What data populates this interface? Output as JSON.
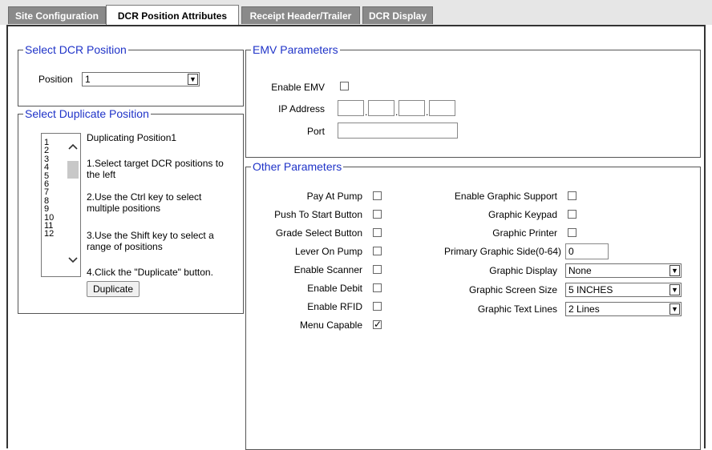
{
  "tabs": [
    {
      "label": "Site Configuration"
    },
    {
      "label": "DCR Position Attributes"
    },
    {
      "label": "Receipt Header/Trailer"
    },
    {
      "label": "DCR Display"
    }
  ],
  "active_tab": "DCR Position Attributes",
  "select_dcr_position": {
    "legend": "Select DCR Position",
    "position_label": "Position",
    "position_value": "1"
  },
  "select_duplicate_position": {
    "legend": "Select Duplicate Position",
    "list_items": [
      "1",
      "2",
      "3",
      "4",
      "5",
      "6",
      "7",
      "8",
      "9",
      "10",
      "11",
      "12"
    ],
    "heading": "Duplicating Position1",
    "instructions": [
      "1.Select target DCR positions to the left",
      "2.Use the Ctrl key to select multiple positions",
      "3.Use the Shift key to select a range of positions",
      "4.Click the \"Duplicate\" button."
    ],
    "button_label": "Duplicate"
  },
  "emv": {
    "legend": "EMV Parameters",
    "enable_label": "Enable EMV",
    "enable_checked": false,
    "ip_label": "IP Address",
    "ip_segments": [
      "",
      "",
      "",
      ""
    ],
    "port_label": "Port",
    "port_value": ""
  },
  "other": {
    "legend": "Other Parameters",
    "left_checks": [
      {
        "label": "Pay At Pump",
        "checked": false
      },
      {
        "label": "Push To Start Button",
        "checked": false
      },
      {
        "label": "Grade Select Button",
        "checked": false
      },
      {
        "label": "Lever On Pump",
        "checked": false
      },
      {
        "label": "Enable Scanner",
        "checked": false
      },
      {
        "label": "Enable Debit",
        "checked": false
      },
      {
        "label": "Enable RFID",
        "checked": false
      },
      {
        "label": "Menu Capable",
        "checked": true
      }
    ],
    "right_checks": [
      {
        "label": "Enable Graphic Support",
        "checked": false
      },
      {
        "label": "Graphic Keypad",
        "checked": false
      },
      {
        "label": "Graphic Printer",
        "checked": false
      }
    ],
    "primary_side_label": "Primary Graphic Side(0-64)",
    "primary_side_value": "0",
    "graphic_display_label": "Graphic Display",
    "graphic_display_value": "None",
    "graphic_screen_size_label": "Graphic Screen Size",
    "graphic_screen_size_value": "5 INCHES",
    "graphic_text_lines_label": "Graphic Text Lines",
    "graphic_text_lines_value": "2 Lines"
  },
  "icons": {
    "dropdown": "chevron-down-icon",
    "scroll_up": "chevron-up-icon",
    "scroll_down": "chevron-down-icon",
    "checkmark": "checkmark-icon"
  },
  "colors": {
    "legend_text": "#1f33c8",
    "tab_inactive_bg": "#8a8a8a",
    "tab_active_bg": "#ffffff",
    "tabstrip_bg": "#e6e6e6"
  }
}
